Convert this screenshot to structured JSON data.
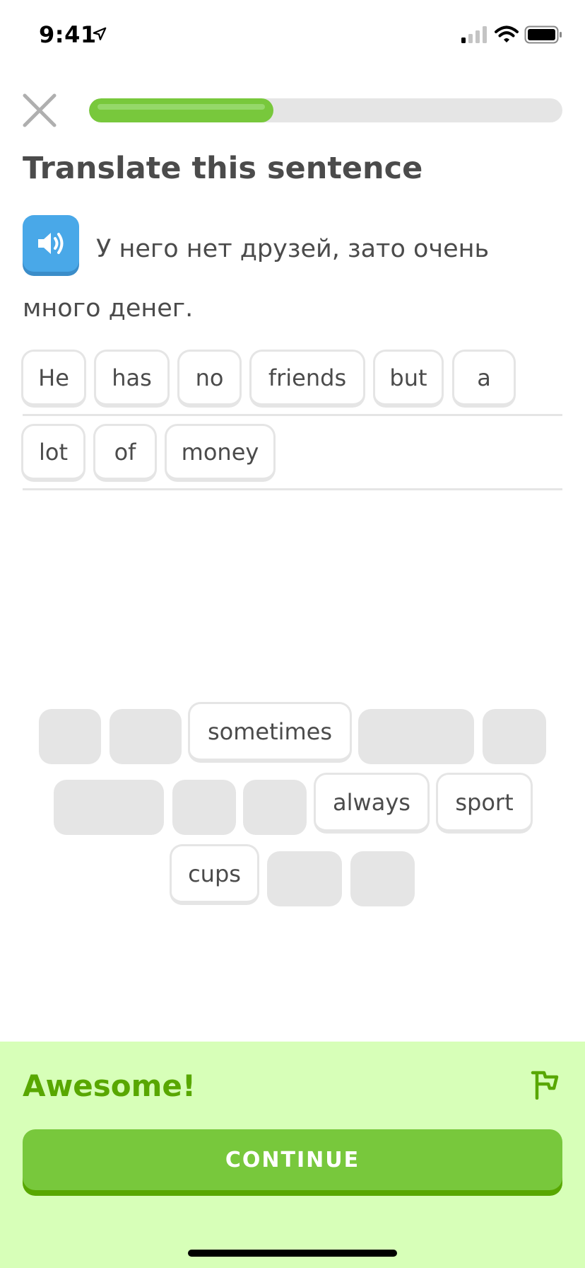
{
  "status_bar": {
    "time": "9:41",
    "icons": [
      "location-arrow-icon",
      "cellular-signal-icon",
      "wifi-icon",
      "battery-icon"
    ]
  },
  "header": {
    "close_icon": "close-icon",
    "progress_fraction": 0.39
  },
  "exercise": {
    "title": "Translate this sentence",
    "speaker_icon": "speaker-icon",
    "prompt": "У него нет друзей, зато очень много денег."
  },
  "answer": {
    "words": [
      "He",
      "has",
      "no",
      "friends",
      "but",
      "a",
      "lot",
      "of",
      "money"
    ]
  },
  "word_bank": {
    "available": [
      "sometimes",
      "always",
      "sport",
      "cups"
    ]
  },
  "feedback": {
    "message": "Awesome!",
    "flag_icon": "report-flag-icon",
    "continue_label": "CONTINUE"
  },
  "colors": {
    "accent_green": "#78c83c",
    "feedback_bg": "#d7ffb8",
    "feedback_text": "#58a700",
    "speaker_blue": "#49a8e8",
    "tile_border": "#e5e5e5"
  }
}
